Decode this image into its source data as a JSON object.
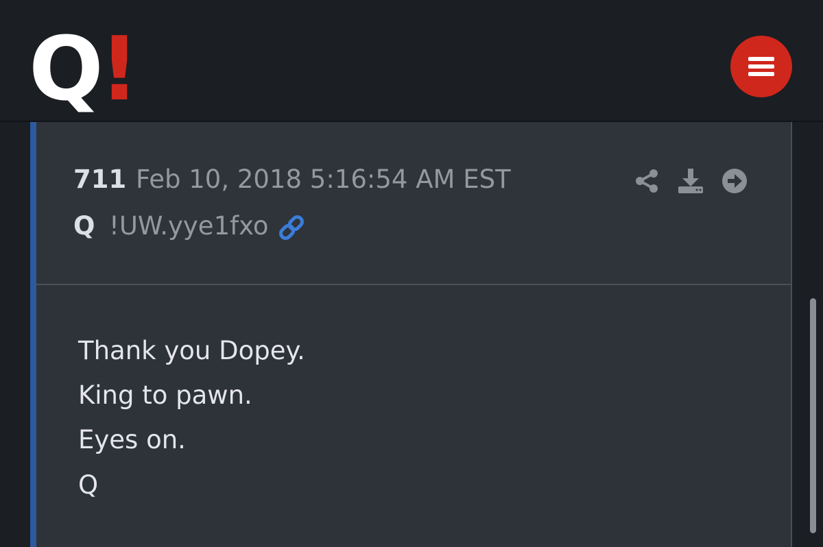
{
  "header": {
    "logo": {
      "letter": "Q",
      "mark": "!"
    },
    "menu_icon": "hamburger-icon"
  },
  "post": {
    "number": "711",
    "date": "Feb 10, 2018 5:16:54 AM EST",
    "author": "Q",
    "tripcode": "!UW.yye1fxo",
    "link_icon": "link-icon",
    "actions": [
      "share-icon",
      "download-icon",
      "arrow-right-circle-icon"
    ],
    "body_lines": [
      "Thank you Dopey.",
      "King to pawn.",
      "Eyes on.",
      "Q"
    ]
  },
  "colors": {
    "background": "#1b1e22",
    "card": "#2e3239",
    "accent_bar": "#2b5a9e",
    "brand_red": "#d0271d",
    "link_blue": "#3b7dd8",
    "muted_text": "#9399a1",
    "body_text": "#e4e6e9"
  }
}
